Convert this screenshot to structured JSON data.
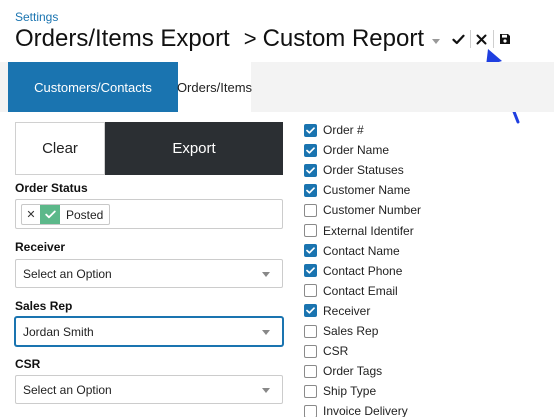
{
  "header": {
    "breadcrumb": "Settings",
    "title": "Orders/Items Export",
    "separator": ">",
    "report": "Custom Report",
    "actions": [
      "check-icon",
      "close-icon",
      "save-icon"
    ]
  },
  "tabs": [
    {
      "label": "Customers/Contacts",
      "active": true
    },
    {
      "label": "Orders/Items",
      "active": false
    }
  ],
  "buttons": {
    "clear": "Clear",
    "export": "Export"
  },
  "filters": {
    "order_status": {
      "label": "Order Status",
      "tag": "Posted",
      "tag_color": "#5cb88a"
    },
    "receiver": {
      "label": "Receiver",
      "value": "Select an Option"
    },
    "sales_rep": {
      "label": "Sales Rep",
      "value": "Jordan Smith"
    },
    "csr": {
      "label": "CSR",
      "value": "Select an Option"
    }
  },
  "columns": [
    {
      "label": "Order #",
      "checked": true
    },
    {
      "label": "Order Name",
      "checked": true
    },
    {
      "label": "Order Statuses",
      "checked": true
    },
    {
      "label": "Customer Name",
      "checked": true
    },
    {
      "label": "Customer Number",
      "checked": false
    },
    {
      "label": "External Identifer",
      "checked": false
    },
    {
      "label": "Contact Name",
      "checked": true
    },
    {
      "label": "Contact Phone",
      "checked": true
    },
    {
      "label": "Contact Email",
      "checked": false
    },
    {
      "label": "Receiver",
      "checked": true
    },
    {
      "label": "Sales Rep",
      "checked": false
    },
    {
      "label": "CSR",
      "checked": false
    },
    {
      "label": "Order Tags",
      "checked": false
    },
    {
      "label": "Ship Type",
      "checked": false
    },
    {
      "label": "Invoice Delivery",
      "checked": false
    }
  ],
  "colors": {
    "accent": "#1a74b0",
    "dark": "#2b2f33",
    "annotation": "#1f3fe0"
  }
}
